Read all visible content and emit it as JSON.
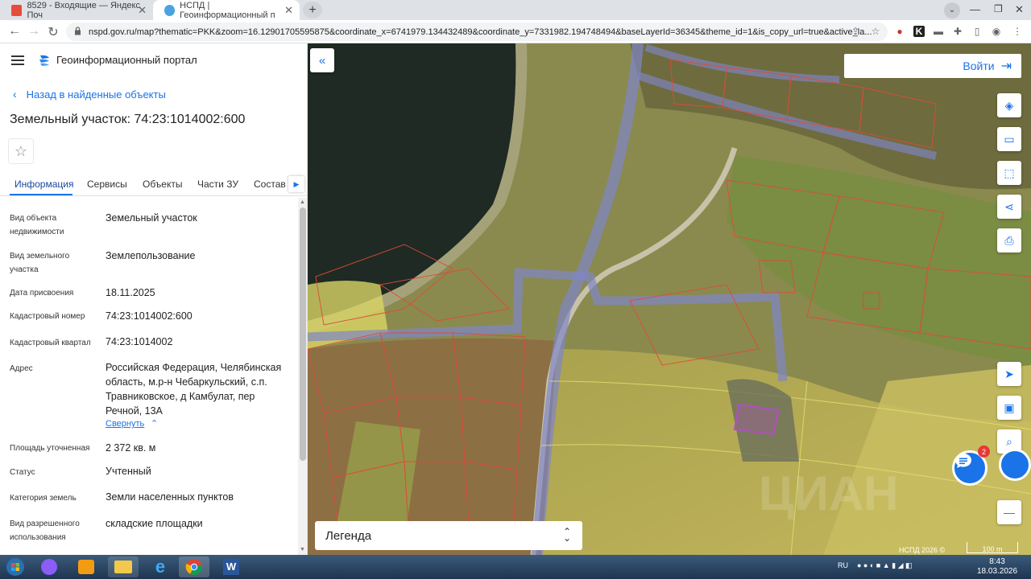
{
  "browser": {
    "tabs": [
      {
        "title": "8529 - Входящие — Яндекс Поч"
      },
      {
        "title": "НСПД | Геоинформационный п"
      }
    ],
    "url": "nspd.gov.ru/map?thematic=PKK&zoom=16.12901705595875&coordinate_x=6741979.134432489&coordinate_y=7331982.194748494&baseLayerId=36345&theme_id=1&is_copy_url=true&active_la..."
  },
  "header": {
    "title": "Геоинформационный портал"
  },
  "panel": {
    "back_label": "Назад в найденные объекты",
    "title": "Земельный участок: 74:23:1014002:600",
    "tabs": [
      "Информация",
      "Сервисы",
      "Объекты",
      "Части ЗУ",
      "Состав"
    ],
    "fields": [
      {
        "label": "Вид объекта недвижимости",
        "value": "Земельный участок"
      },
      {
        "label": "Вид земельного участка",
        "value": "Землепользование"
      },
      {
        "label": "Дата присвоения",
        "value": "18.11.2025"
      },
      {
        "label": "Кадастровый номер",
        "value": "74:23:1014002:600"
      },
      {
        "label": "Кадастровый квартал",
        "value": "74:23:1014002"
      },
      {
        "label": "Адрес",
        "value": "Российская Федерация, Челябинская область, м.р-н Чебаркульский, с.п. Травниковское, д Камбулат, пер Речной, 13А"
      },
      {
        "label": "Площадь уточненная",
        "value": "2 372 кв. м"
      },
      {
        "label": "Статус",
        "value": "Учтенный"
      },
      {
        "label": "Категория земель",
        "value": "Земли населенных пунктов"
      },
      {
        "label": "Вид разрешенного использования",
        "value": "складские площадки"
      }
    ],
    "collapse_label": "Свернуть"
  },
  "map": {
    "login_label": "Войти",
    "legend_label": "Легенда",
    "chat_badge": "2",
    "copyright": "НСПД 2026 ©",
    "scale_label": "100 m",
    "watermark": "ЦИАН"
  },
  "taskbar": {
    "lang": "RU",
    "time": "8:43",
    "date": "18.03.2026"
  }
}
